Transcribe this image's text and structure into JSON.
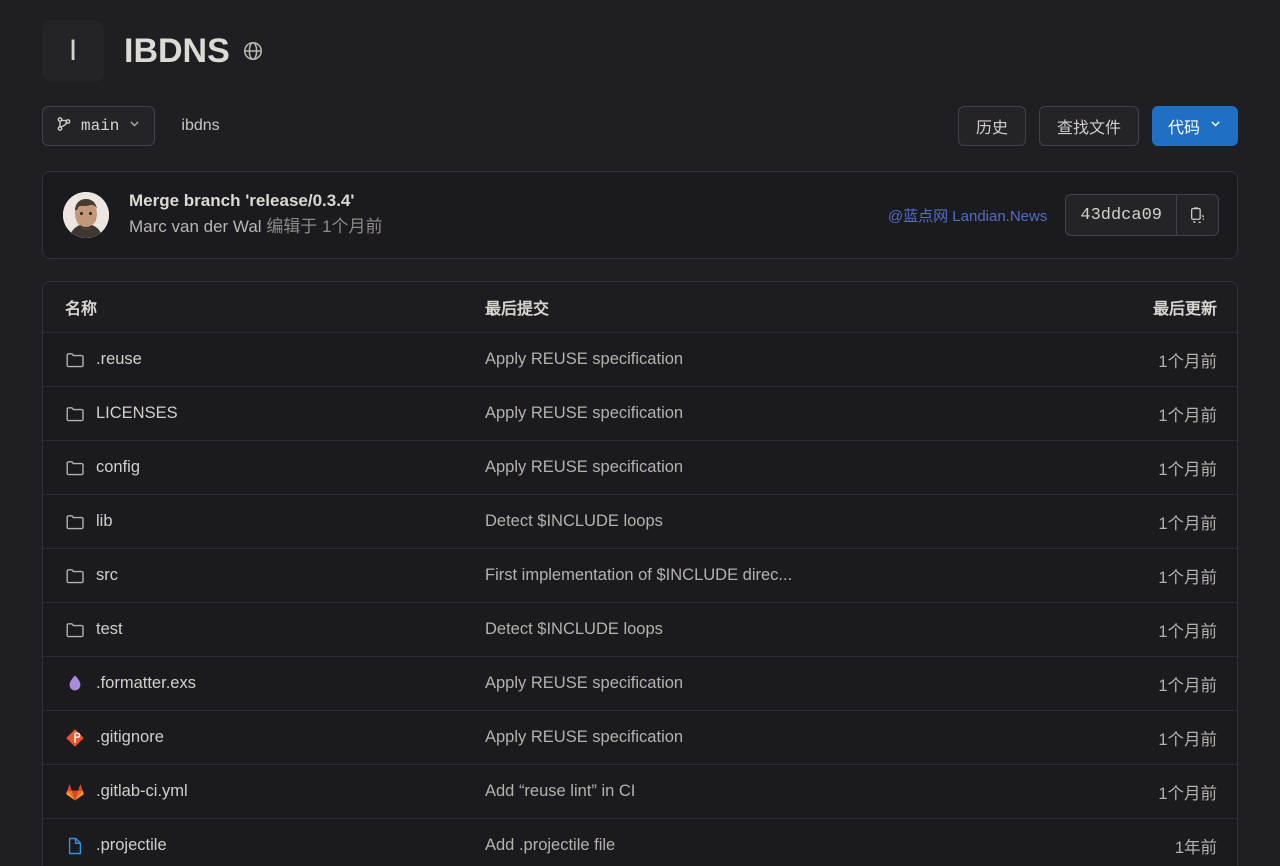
{
  "header": {
    "avatar_letter": "I",
    "title": "IBDNS",
    "visibility_icon": "globe-icon"
  },
  "toolbar": {
    "branch": "main",
    "branch_icon": "branch-icon",
    "chevron_icon": "chevron-down-icon",
    "breadcrumb": "ibdns",
    "history_label": "历史",
    "find_file_label": "查找文件",
    "code_label": "代码"
  },
  "commit": {
    "message": "Merge branch 'release/0.3.4'",
    "author": "Marc van der Wal",
    "action": "编辑于",
    "time": "1个月前",
    "watermark": "@蓝点网 Landian.News",
    "sha": "43ddca09",
    "copy_icon": "copy-icon"
  },
  "table": {
    "headers": {
      "name": "名称",
      "last_commit": "最后提交",
      "last_update": "最后更新"
    },
    "rows": [
      {
        "name": ".reuse",
        "icon": "folder-icon",
        "commit": "Apply REUSE specification",
        "time": "1个月前"
      },
      {
        "name": "LICENSES",
        "icon": "folder-icon",
        "commit": "Apply REUSE specification",
        "time": "1个月前"
      },
      {
        "name": "config",
        "icon": "folder-icon",
        "commit": "Apply REUSE specification",
        "time": "1个月前"
      },
      {
        "name": "lib",
        "icon": "folder-icon",
        "commit": "Detect $INCLUDE loops",
        "time": "1个月前"
      },
      {
        "name": "src",
        "icon": "folder-icon",
        "commit": "First implementation of $INCLUDE direc...",
        "time": "1个月前"
      },
      {
        "name": "test",
        "icon": "folder-icon",
        "commit": "Detect $INCLUDE loops",
        "time": "1个月前"
      },
      {
        "name": ".formatter.exs",
        "icon": "elixir-icon",
        "commit": "Apply REUSE specification",
        "time": "1个月前"
      },
      {
        "name": ".gitignore",
        "icon": "git-icon",
        "commit": "Apply REUSE specification",
        "time": "1个月前"
      },
      {
        "name": ".gitlab-ci.yml",
        "icon": "gitlab-icon",
        "commit": "Add “reuse lint” in CI",
        "time": "1个月前"
      },
      {
        "name": ".projectile",
        "icon": "file-icon",
        "commit": "Add .projectile file",
        "time": "1年前"
      }
    ]
  },
  "colors": {
    "page_bg": "#1f1f23",
    "panel_bg": "#1b1b1f",
    "border": "#33323a",
    "primary": "#1f6fc4",
    "text": "#d2cfc9",
    "muted": "#b5b2ac",
    "watermark": "#4f6ec4",
    "elixir": "#a98bdb",
    "git": "#f0502a",
    "gitlab": "#fc6d26",
    "file": "#2f93e0"
  }
}
